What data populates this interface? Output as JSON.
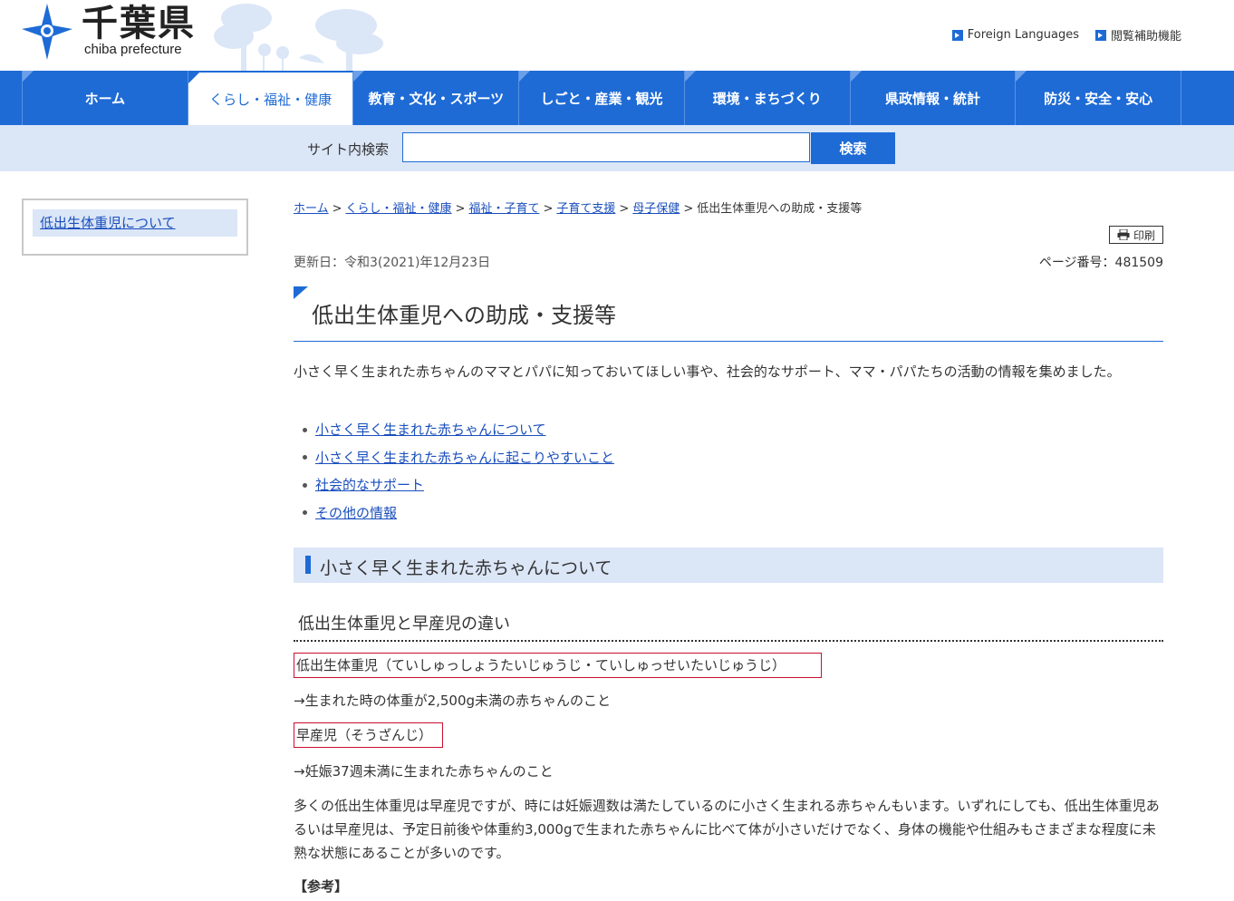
{
  "header": {
    "logo_title": "千葉県",
    "logo_sub": "chiba prefecture",
    "links": [
      "Foreign Languages",
      "閲覧補助機能"
    ]
  },
  "nav": {
    "items": [
      "ホーム",
      "くらし・福祉・健康",
      "教育・文化・スポーツ",
      "しごと・産業・観光",
      "環境・まちづくり",
      "県政情報・統計",
      "防災・安全・安心"
    ],
    "active_index": 1
  },
  "search": {
    "label": "サイト内検索",
    "value": "",
    "placeholder": "",
    "button": "検索"
  },
  "sidebar": {
    "items": [
      "低出生体重児について"
    ]
  },
  "breadcrumb": {
    "links": [
      "ホーム",
      "くらし・福祉・健康",
      "福祉・子育て",
      "子育て支援",
      "母子保健"
    ],
    "current": "低出生体重児への助成・支援等",
    "separator": ">"
  },
  "print_label": "印刷",
  "meta": {
    "updated": "更新日：令和3(2021)年12月23日",
    "page_number": "ページ番号：481509"
  },
  "title": "低出生体重児への助成・支援等",
  "intro": "小さく早く生まれた赤ちゃんのママとパパに知っておいてほしい事や、社会的なサポート、ママ・パパたちの活動の情報を集めました。",
  "toc": [
    "小さく早く生まれた赤ちゃんについて",
    "小さく早く生まれた赤ちゃんに起こりやすいこと",
    "社会的なサポート",
    "その他の情報"
  ],
  "section1": {
    "heading": "小さく早く生まれた赤ちゃんについて",
    "subheading": "低出生体重児と早産児の違い",
    "term1": "低出生体重児（ていしゅっしょうたいじゅうじ・ていしゅっせいたいじゅうじ）",
    "def1": "→生まれた時の体重が2,500g未満の赤ちゃんのこと",
    "term2": "早産児（そうざんじ）",
    "def2": "→妊娠37週未満に生まれた赤ちゃんのこと",
    "body": "多くの低出生体重児は早産児ですが、時には妊娠週数は満たしているのに小さく生まれる赤ちゃんもいます。いずれにしても、低出生体重児あるいは早産児は、予定日前後や体重約3,000gで生まれた赤ちゃんに比べて体が小さいだけでなく、身体の機能や仕組みもさまざまな程度に未熟な状態にあることが多いのです。",
    "reference": "【参考】"
  },
  "colors": {
    "accent": "#1e6bd6",
    "light_bg": "#dbe6f7",
    "box_border": "#c8102e"
  }
}
